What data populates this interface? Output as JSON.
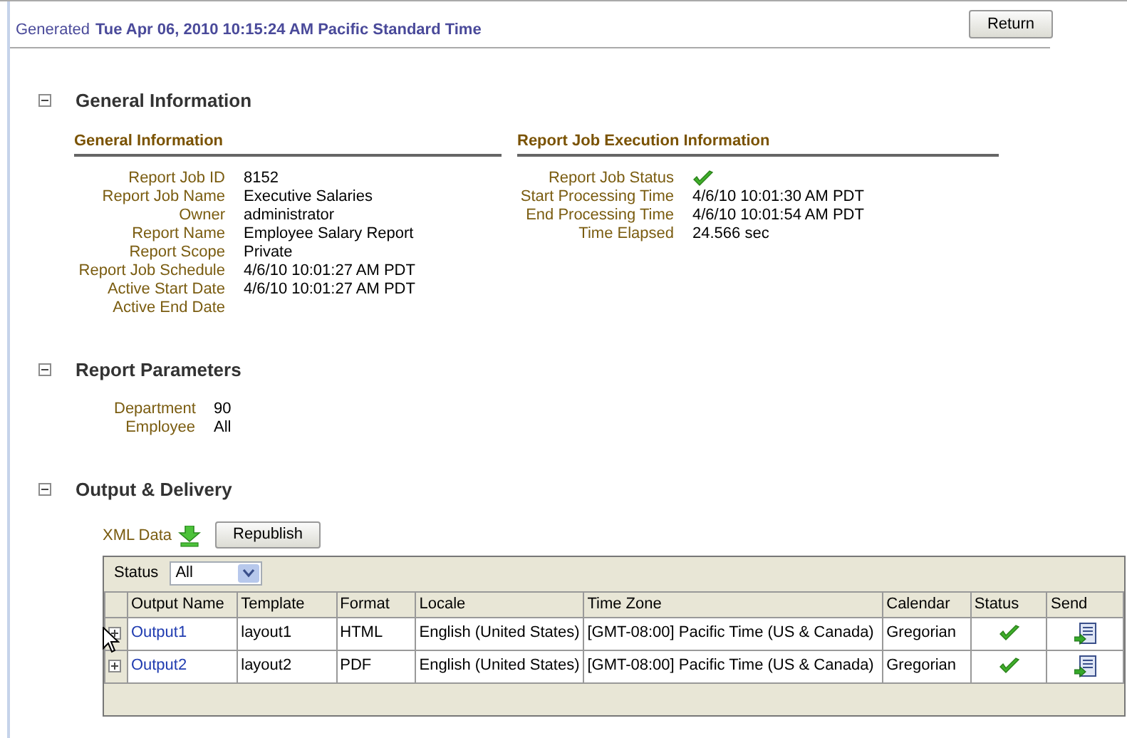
{
  "header": {
    "generated_label": "Generated",
    "generated_value": "Tue Apr 06, 2010 10:15:24 AM Pacific Standard Time",
    "return_button": "Return"
  },
  "sections": [
    {
      "kind": "info",
      "title": "General Information",
      "expanded": true,
      "panels": [
        {
          "heading": "General Information",
          "fields": [
            {
              "label": "Report Job ID",
              "value": "8152"
            },
            {
              "label": "Report Job Name",
              "value": "Executive Salaries"
            },
            {
              "label": "Owner",
              "value": "administrator"
            },
            {
              "label": "Report Name",
              "value": "Employee Salary Report"
            },
            {
              "label": "Report Scope",
              "value": "Private"
            },
            {
              "label": "Report Job Schedule",
              "value": "4/6/10 10:01:27 AM PDT"
            },
            {
              "label": "Active Start Date",
              "value": "4/6/10 10:01:27 AM PDT"
            },
            {
              "label": "Active End Date"
            }
          ]
        },
        {
          "heading": "Report Job Execution Information",
          "fields": [
            {
              "label": "Report Job Status",
              "succeeded": true
            },
            {
              "label": "Start Processing Time",
              "value": "4/6/10 10:01:30 AM PDT"
            },
            {
              "label": "End Processing Time",
              "value": "4/6/10 10:01:54 AM PDT"
            },
            {
              "label": "Time Elapsed",
              "value": "24.566 sec"
            }
          ]
        }
      ]
    },
    {
      "kind": "params",
      "title": "Report Parameters",
      "expanded": true,
      "fields": [
        {
          "label": "Department",
          "value": "90"
        },
        {
          "label": "Employee",
          "value": "All"
        }
      ]
    },
    {
      "kind": "output",
      "title": "Output & Delivery",
      "expanded": true,
      "xml_label": "XML Data",
      "republish_button": "Republish",
      "filter": {
        "label": "Status",
        "value": "All"
      },
      "columns": [
        "Output Name",
        "Template",
        "Format",
        "Locale",
        "Time Zone",
        "Calendar",
        "Status",
        "Send"
      ],
      "rows": [
        {
          "expanded": false,
          "name": "Output1",
          "template": "layout1",
          "format": "HTML",
          "locale": "English (United States)",
          "time_zone": "[GMT-08:00] Pacific Time (US & Canada)",
          "calendar": "Gregorian",
          "succeeded": true
        },
        {
          "expanded": false,
          "name": "Output2",
          "template": "layout2",
          "format": "PDF",
          "locale": "English (United States)",
          "time_zone": "[GMT-08:00] Pacific Time (US & Canada)",
          "calendar": "Gregorian",
          "succeeded": true
        }
      ]
    }
  ]
}
